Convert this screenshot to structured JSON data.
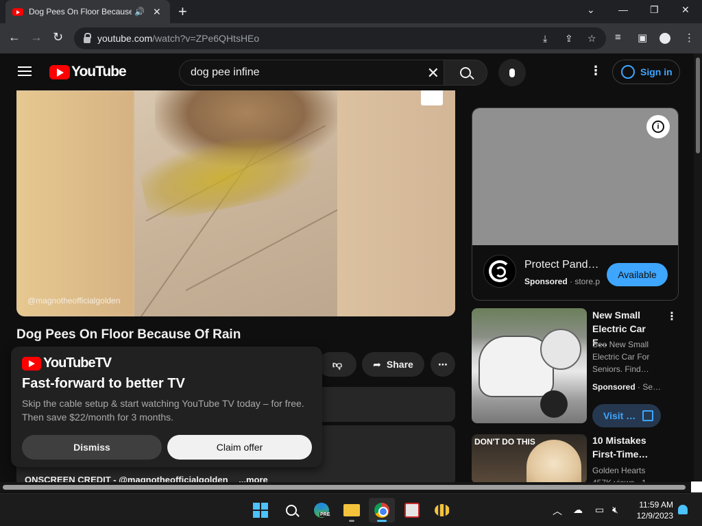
{
  "browser": {
    "tab_title": "Dog Pees On Floor Because Of Rain",
    "url_host": "youtube.com",
    "url_path": "/watch?v=ZPe6QHtsHEo"
  },
  "youtube": {
    "logo_text": "YouTube",
    "search_query": "dog pee infine",
    "signin_label": "Sign in"
  },
  "video": {
    "watermark": "@magnotheofficialgolden",
    "title": "Dog Pees On Floor Because Of Rain",
    "share_label": "Share",
    "description_preview": "ONSCREEN CREDIT - @magnotheofficialgolden",
    "more_label": "...more"
  },
  "promo": {
    "brand": "YouTubeTV",
    "title": "Fast-forward to better TV",
    "body": "Skip the cable setup & start watching YouTube TV today – for free. Then save $22/month for 3 months.",
    "dismiss_label": "Dismiss",
    "claim_label": "Claim offer"
  },
  "sidebar_ad": {
    "title": "Protect Pand…",
    "sponsored_label": "Sponsored",
    "domain": "· store.p",
    "cta_label": "Available"
  },
  "recommendations": [
    {
      "title": "New Small Electric Car F…",
      "subtitle": "See New Small Electric Car For Seniors. Find…",
      "sponsored_label": "Sponsored",
      "meta": "· Se…",
      "cta_label": "Visit …"
    },
    {
      "thumb_caption": "DON'T DO THIS",
      "title": "10 Mistakes First-Time…",
      "channel": "Golden Hearts",
      "meta": "457K views · 1…"
    }
  ],
  "taskbar": {
    "time": "11:59 AM",
    "date": "12/9/2023",
    "edge_badge": "PRE"
  }
}
